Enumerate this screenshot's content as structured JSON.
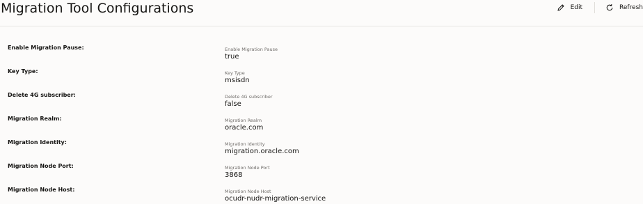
{
  "header": {
    "title": "Migration Tool Configurations",
    "edit_label": "Edit",
    "refresh_label": "Refresh",
    "edit_icon": "pencil-icon",
    "refresh_icon": "refresh-icon"
  },
  "fields": [
    {
      "label": "Enable Migration Pause:",
      "field_label": "Enable Migration Pause",
      "value": "true"
    },
    {
      "label": "Key Type:",
      "field_label": "Key Type",
      "value": "msisdn"
    },
    {
      "label": "Delete 4G subscriber:",
      "field_label": "Delete 4G subscriber",
      "value": "false"
    },
    {
      "label": "Migration Realm:",
      "field_label": "Migration Realm",
      "value": "oracle.com"
    },
    {
      "label": "Migration Identity:",
      "field_label": "Migration Identity",
      "value": "migration.oracle.com"
    },
    {
      "label": "Migration Node Port:",
      "field_label": "Migration Node Port",
      "value": "3868"
    },
    {
      "label": "Migration Node Host:",
      "field_label": "Migration Node Host",
      "value": "ocudr-nudr-migration-service"
    }
  ]
}
